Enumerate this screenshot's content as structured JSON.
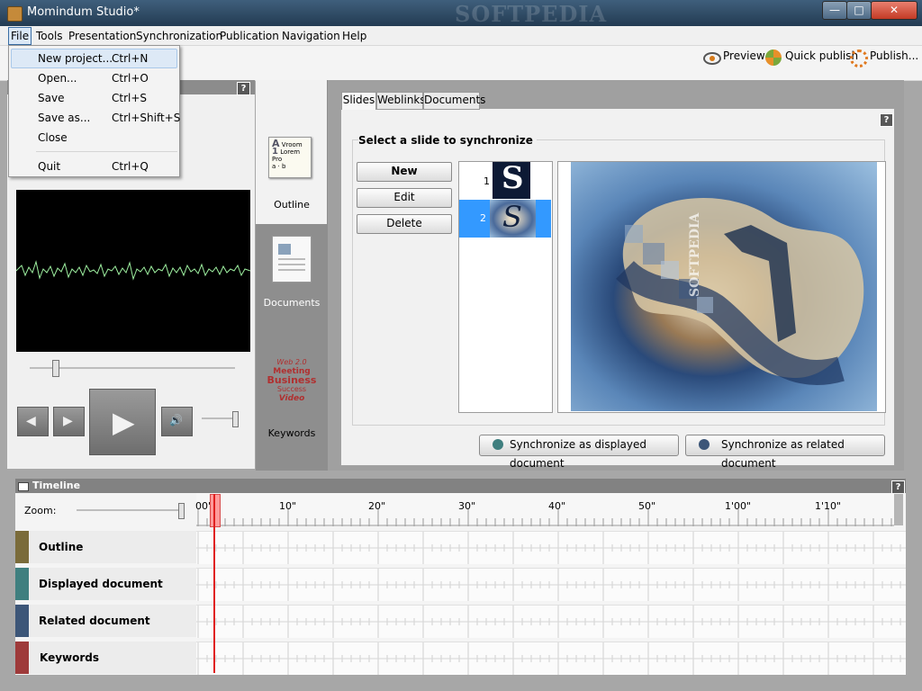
{
  "window": {
    "title": "Momindum Studio*",
    "minimize_glyph": "—",
    "maximize_glyph": "□",
    "close_glyph": "✕",
    "watermark": "SOFTPEDIA"
  },
  "menubar": {
    "items": [
      "File",
      "Tools",
      "Presentation",
      "Synchronization",
      "Publication",
      "Navigation",
      "Help"
    ]
  },
  "file_menu": {
    "items": [
      {
        "label": "New project...",
        "shortcut": "Ctrl+N"
      },
      {
        "label": "Open...",
        "shortcut": "Ctrl+O"
      },
      {
        "label": "Save",
        "shortcut": "Ctrl+S"
      },
      {
        "label": "Save as...",
        "shortcut": "Ctrl+Shift+S"
      },
      {
        "label": "Close",
        "shortcut": ""
      },
      {
        "label": "Quit",
        "shortcut": "Ctrl+Q"
      }
    ]
  },
  "toolbar": {
    "preview": "Preview",
    "quick_publish": "Quick publish",
    "publish": "Publish..."
  },
  "help_glyph": "?",
  "categories": {
    "outline": "Outline",
    "documents": "Documents",
    "keywords": "Keywords",
    "keyword_cloud": [
      "Web 2.0",
      "Meeting",
      "Business",
      "Success",
      "Video"
    ],
    "outline_thumb_text": [
      "A",
      "Vroom",
      "1",
      "Lorem Pro",
      "a",
      "b"
    ]
  },
  "tabs": [
    "Slides",
    "Weblinks",
    "Documents"
  ],
  "slides_panel": {
    "title": "Select a slide to synchronize",
    "buttons": {
      "new": "New",
      "edit": "Edit",
      "delete": "Delete"
    },
    "slides": [
      {
        "number": "1",
        "glyph": "S"
      },
      {
        "number": "2",
        "glyph": "S"
      }
    ],
    "selected_slide": 2,
    "preview_watermark": "SOFTPEDIA",
    "sync_displayed": "Synchronize as displayed document",
    "sync_related": "Synchronize as related document"
  },
  "timeline": {
    "title": "Timeline",
    "zoom_label": "Zoom:",
    "zoom_level": 1.0,
    "ticks": [
      "00\"",
      "10\"",
      "20\"",
      "30\"",
      "40\"",
      "50\"",
      "1'00\"",
      "1'10\""
    ],
    "tracks": [
      {
        "label": "Outline",
        "color": "#7a6b3a"
      },
      {
        "label": "Displayed document",
        "color": "#3f7f7f"
      },
      {
        "label": "Related document",
        "color": "#3d5678"
      },
      {
        "label": "Keywords",
        "color": "#9e3a3a"
      }
    ]
  },
  "player": {
    "prev_glyph": "◀",
    "step_glyph": "▶",
    "play_glyph": "▶",
    "volume_glyph": "🔊",
    "seek_position": 0.11,
    "volume": 1.0
  },
  "colors": {
    "accent_selection": "#3399ff",
    "waveform": "#9ef0a0",
    "playhead": "#e02020"
  }
}
